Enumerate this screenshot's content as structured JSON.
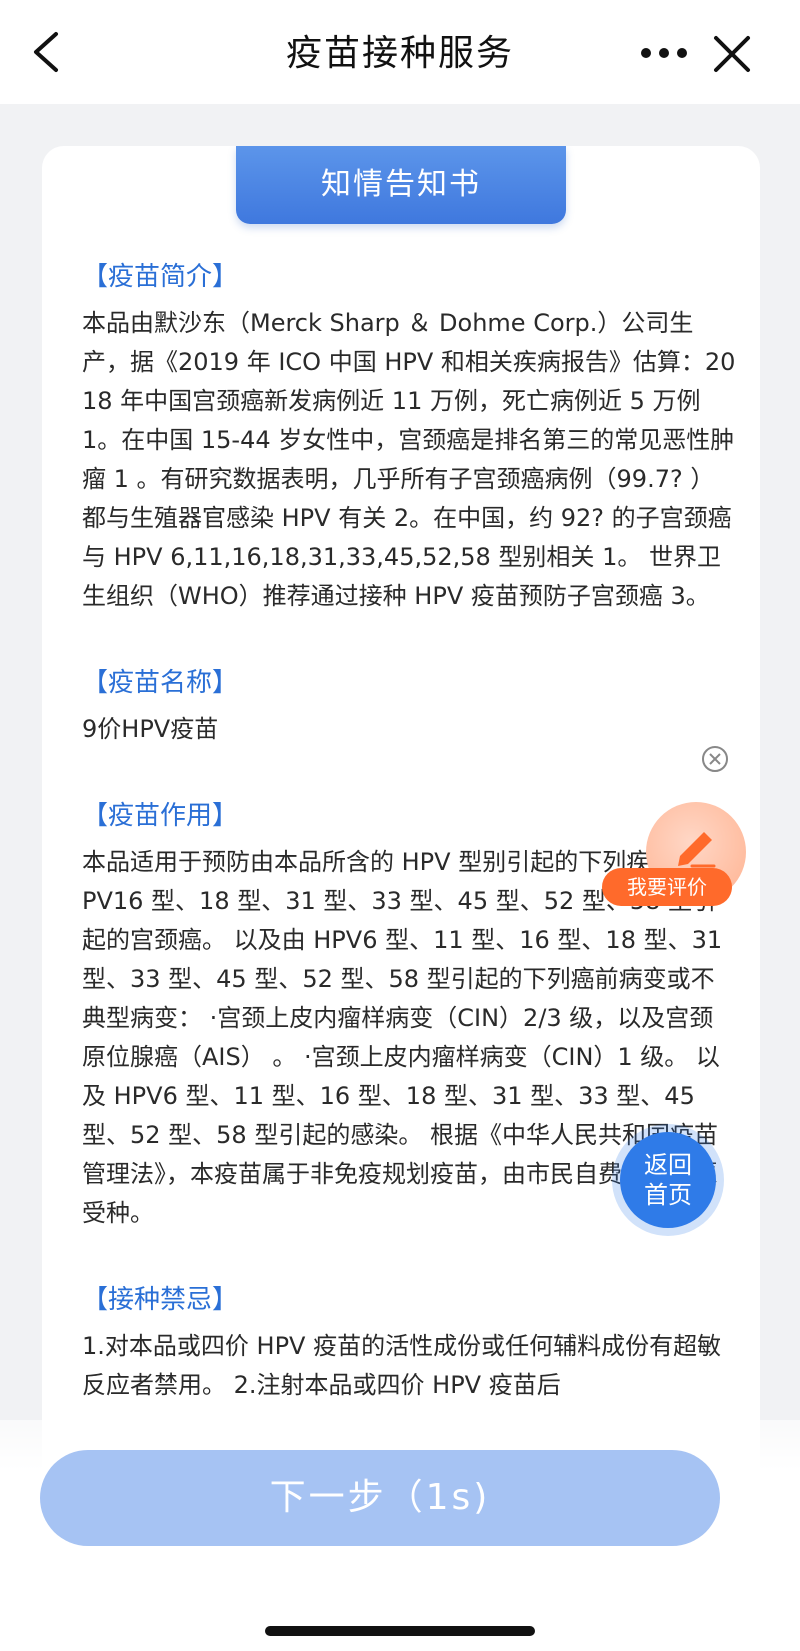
{
  "nav": {
    "title": "疫苗接种服务",
    "back_icon": "chevron-left-icon",
    "more_icon": "more-dots-icon",
    "close_icon": "close-icon"
  },
  "card": {
    "tab_label": "知情告知书",
    "sections": [
      {
        "title": "【疫苗简介】",
        "body": "本品由默沙东（Merck Sharp ＆ Dohme Corp.）公司生产，据《2019 年 ICO 中国 HPV 和相关疾病报告》估算：2018 年中国宫颈癌新发病例近 11 万例，死亡病例近 5 万例 1。在中国 15-44 岁女性中，宫颈癌是排名第三的常见恶性肿瘤 1 。有研究数据表明，几乎所有子宫颈癌病例（99.7? ）都与生殖器官感染 HPV 有关 2。在中国，约 92? 的子宫颈癌与 HPV 6,11,16,18,31,33,45,52,58 型别相关 1。 世界卫生组织（WHO）推荐通过接种 HPV 疫苗预防子宫颈癌 3。"
      },
      {
        "title": "【疫苗名称】",
        "body": "9价HPV疫苗"
      },
      {
        "title": "【疫苗作用】",
        "body": "本品适用于预防由本品所含的 HPV 型别引起的下列疾病： ·HPV16 型、18 型、31 型、33 型、45 型、52 型、58 型引起的宫颈癌。 以及由 HPV6 型、11 型、16 型、18 型、31 型、33 型、45 型、52 型、58 型引起的下列癌前病变或不典型病变： ·宫颈上皮内瘤样病变（CIN）2/3 级，以及宫颈原位腺癌（AIS） 。 ·宫颈上皮内瘤样病变（CIN）1 级。 以及 HPV6 型、11 型、16 型、18 型、31 型、33 型、45 型、52 型、58 型引起的感染。 根据《中华人民共和国疫苗管理法》，本疫苗属于非免疫规划疫苗，由市民自费并且自愿受种。"
      },
      {
        "title": "【接种禁忌】",
        "body": "1.对本品或四价 HPV 疫苗的活性成份或任何辅料成份有超敏反应者禁用。 2.注射本品或四价 HPV 疫苗后"
      }
    ]
  },
  "floating": {
    "evaluate_label": "我要评价",
    "evaluate_icon": "pencil-icon",
    "evaluate_close_icon": "close-circle-icon",
    "home_line1": "返回",
    "home_line2": "首页"
  },
  "footer": {
    "next_label": "下一步（1s)"
  },
  "colors": {
    "accent": "#2a6fd6",
    "tab_blue": "#4a84e2",
    "orange": "#ff6a2b",
    "disabled_button": "#a6c3f3"
  }
}
